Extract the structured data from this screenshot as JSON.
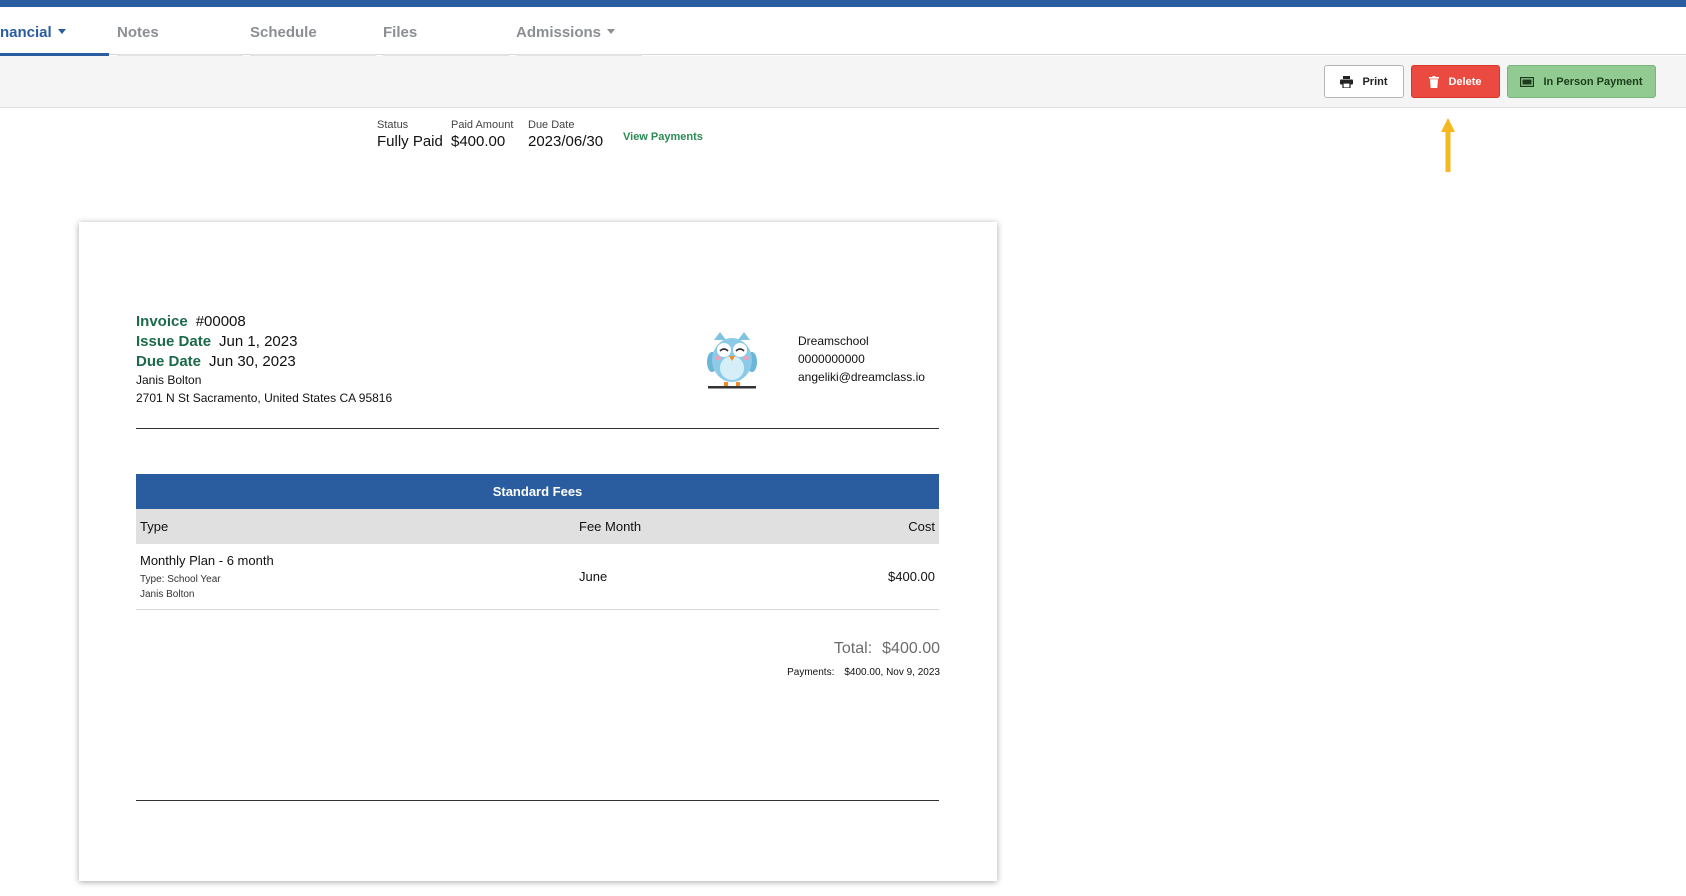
{
  "colors": {
    "brand": "#2a5d9f",
    "danger": "#ea4a3f",
    "success": "#92cb91",
    "label_green": "#1d6a4a",
    "link_green": "#2b8a55",
    "annotation_arrow": "#f5b820"
  },
  "tabs": [
    {
      "label": "nancial",
      "has_dropdown": true,
      "active": true
    },
    {
      "label": "Notes"
    },
    {
      "label": "Schedule"
    },
    {
      "label": "Files"
    },
    {
      "label": "Admissions",
      "has_dropdown": true
    }
  ],
  "toolbar": {
    "print": {
      "label": "Print",
      "icon": "printer-icon"
    },
    "delete": {
      "label": "Delete",
      "icon": "trash-icon"
    },
    "payment": {
      "label": "In Person Payment",
      "icon": "cash-icon"
    }
  },
  "summary": {
    "status_label": "Status",
    "status_value": "Fully Paid",
    "paid_label": "Paid Amount",
    "paid_value": "$400.00",
    "due_label": "Due Date",
    "due_value": "2023/06/30",
    "view_payments": "View Payments"
  },
  "invoice": {
    "number_label": "Invoice",
    "number": "#00008",
    "issue_label": "Issue Date",
    "issue_date": "Jun 1, 2023",
    "due_label": "Due Date",
    "due_date": "Jun 30, 2023",
    "customer_name": "Janis Bolton",
    "customer_address": "2701 N St Sacramento, United States CA 95816",
    "school": {
      "name": "Dreamschool",
      "phone": "0000000000",
      "email": "angeliki@dreamclass.io"
    },
    "fees": {
      "title": "Standard Fees",
      "columns": {
        "type": "Type",
        "month": "Fee Month",
        "cost": "Cost"
      },
      "rows": [
        {
          "type": "Monthly Plan - 6 month",
          "sub_type": "Type: School Year",
          "student": "Janis Bolton",
          "month": "June",
          "cost": "$400.00"
        }
      ]
    },
    "total_label": "Total:",
    "total": "$400.00",
    "payments_label": "Payments:",
    "payments": "$400.00, Nov 9, 2023"
  }
}
